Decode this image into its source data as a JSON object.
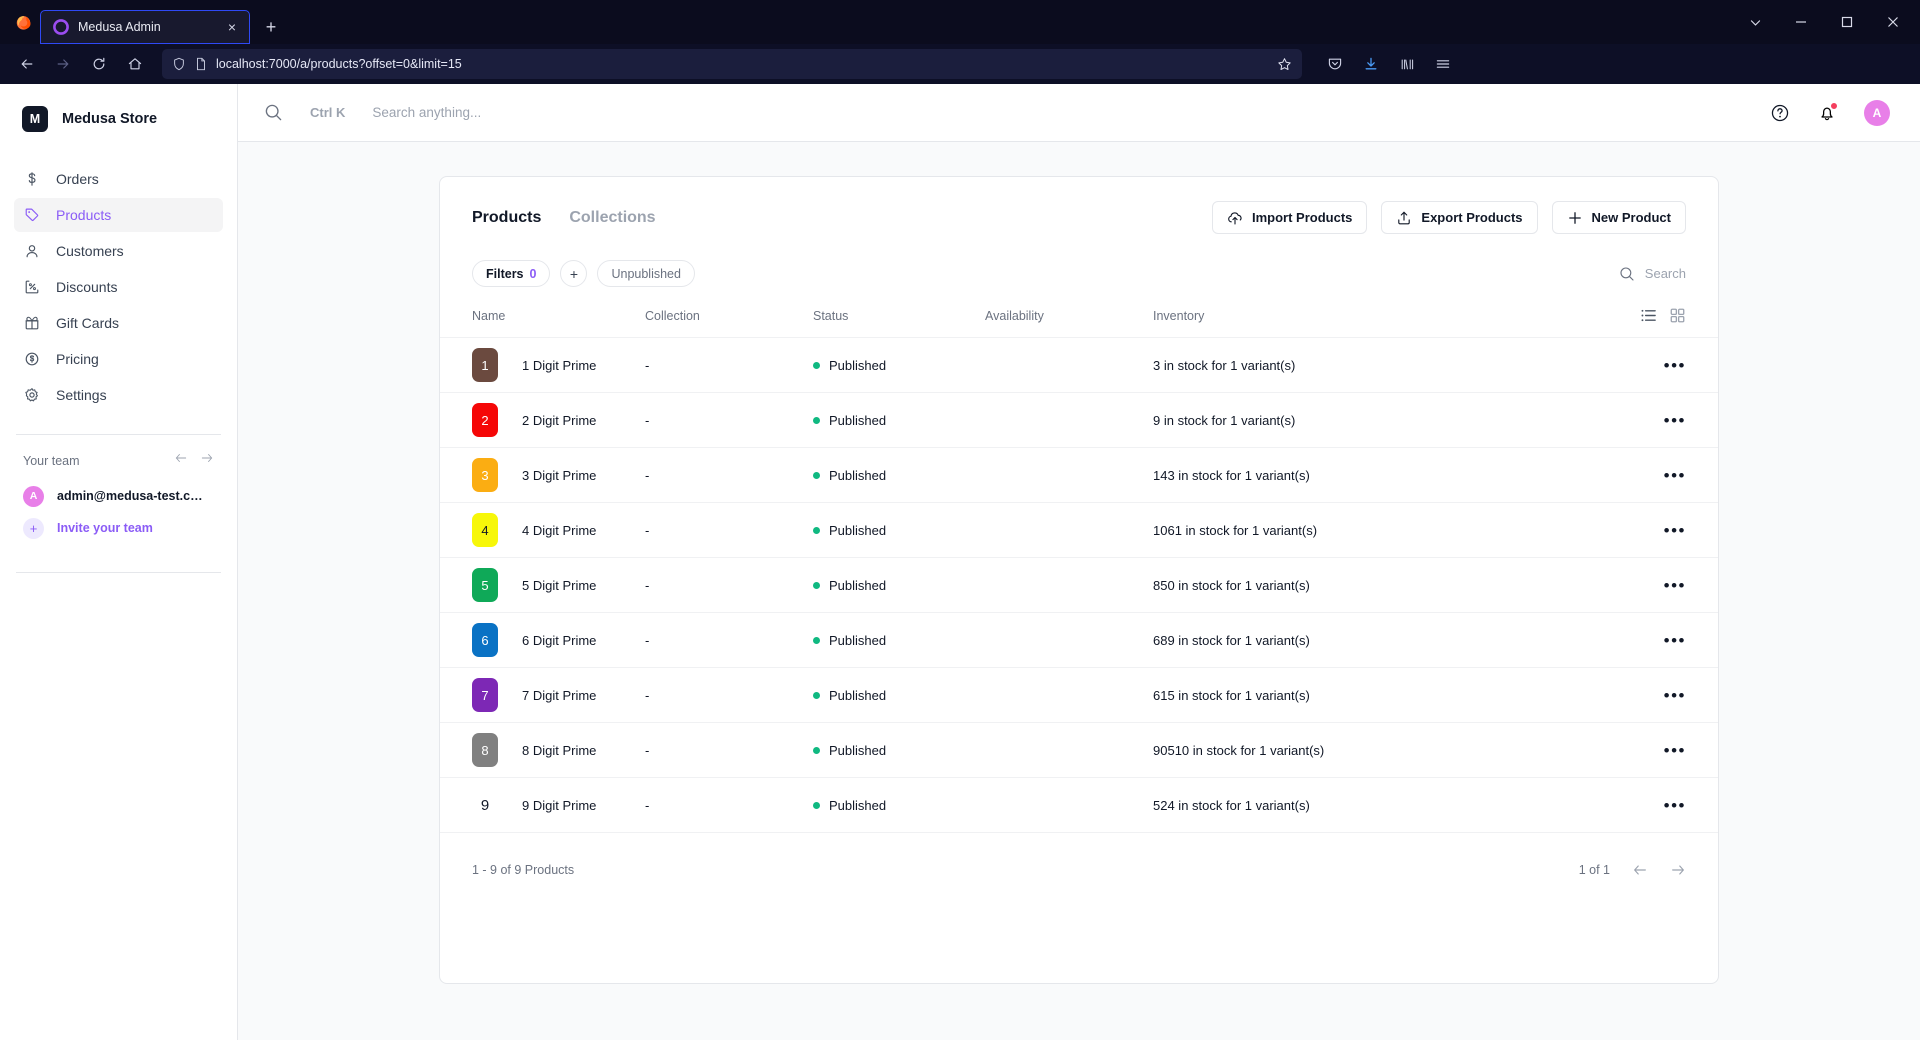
{
  "browser": {
    "tab": {
      "title": "Medusa Admin",
      "favicon": "medusa-favicon",
      "close_label": "×"
    },
    "new_tab_label": "+",
    "url": "localhost:7000/a/products?offset=0&limit=15",
    "window_controls": {
      "minimize": "—",
      "maximize": "□",
      "close": "✕",
      "list_all_tabs": "⌄"
    }
  },
  "sidebar": {
    "store_initial": "M",
    "store_name": "Medusa Store",
    "items": [
      {
        "label": "Orders",
        "icon": "dollar-icon",
        "active": false
      },
      {
        "label": "Products",
        "icon": "tag-icon",
        "active": true
      },
      {
        "label": "Customers",
        "icon": "user-icon",
        "active": false
      },
      {
        "label": "Discounts",
        "icon": "percent-icon",
        "active": false
      },
      {
        "label": "Gift Cards",
        "icon": "gift-icon",
        "active": false
      },
      {
        "label": "Pricing",
        "icon": "coin-dollar-icon",
        "active": false
      },
      {
        "label": "Settings",
        "icon": "gear-icon",
        "active": false
      }
    ],
    "team": {
      "title": "Your team",
      "member_initial": "A",
      "member_email": "admin@medusa-test.co…",
      "member_avatar_color": "#e87fe8",
      "invite_label": "Invite your team",
      "invite_plus": "+"
    }
  },
  "topbar": {
    "search_shortcut": "Ctrl K",
    "search_placeholder": "Search anything...",
    "help_icon": "question-circle-icon",
    "notifications_icon": "bell-icon",
    "avatar_initial": "A",
    "avatar_color": "#e87fe8",
    "notification_dot_color": "#f43f5e"
  },
  "main": {
    "tabs": [
      {
        "label": "Products",
        "active": true
      },
      {
        "label": "Collections",
        "active": false
      }
    ],
    "actions": [
      {
        "label": "Import Products",
        "icon": "cloud-upload-icon"
      },
      {
        "label": "Export Products",
        "icon": "upload-tray-icon"
      },
      {
        "label": "New Product",
        "icon": "plus-icon"
      }
    ],
    "filters": {
      "label": "Filters",
      "count": "0",
      "add_label": "+",
      "saved_label": "Unpublished"
    },
    "table_search_placeholder": "Search",
    "view_modes": [
      {
        "name": "list-view",
        "active": true
      },
      {
        "name": "grid-view",
        "active": false
      }
    ],
    "columns": [
      "Name",
      "Collection",
      "Status",
      "Availability",
      "Inventory"
    ],
    "rows": [
      {
        "thumb": "1",
        "thumb_color": "#6b4a3f",
        "thumb_text_color": "#ffffff",
        "name": "1 Digit Prime",
        "collection": "-",
        "status": "Published",
        "status_color": "#10b981",
        "availability": "",
        "inventory": "3 in stock for 1 variant(s)",
        "menu": "•••"
      },
      {
        "thumb": "2",
        "thumb_color": "#f50707",
        "thumb_text_color": "#ffffff",
        "name": "2 Digit Prime",
        "collection": "-",
        "status": "Published",
        "status_color": "#10b981",
        "availability": "",
        "inventory": "9 in stock for 1 variant(s)",
        "menu": "•••"
      },
      {
        "thumb": "3",
        "thumb_color": "#fbad12",
        "thumb_text_color": "#ffffff",
        "name": "3 Digit Prime",
        "collection": "-",
        "status": "Published",
        "status_color": "#10b981",
        "availability": "",
        "inventory": "143 in stock for 1 variant(s)",
        "menu": "•••"
      },
      {
        "thumb": "4",
        "thumb_color": "#f7f709",
        "thumb_text_color": "#111827",
        "name": "4 Digit Prime",
        "collection": "-",
        "status": "Published",
        "status_color": "#10b981",
        "availability": "",
        "inventory": "1061 in stock for 1 variant(s)",
        "menu": "•••"
      },
      {
        "thumb": "5",
        "thumb_color": "#0fa958",
        "thumb_text_color": "#ffffff",
        "name": "5 Digit Prime",
        "collection": "-",
        "status": "Published",
        "status_color": "#10b981",
        "availability": "",
        "inventory": "850 in stock for 1 variant(s)",
        "menu": "•••"
      },
      {
        "thumb": "6",
        "thumb_color": "#0a72c4",
        "thumb_text_color": "#ffffff",
        "name": "6 Digit Prime",
        "collection": "-",
        "status": "Published",
        "status_color": "#10b981",
        "availability": "",
        "inventory": "689 in stock for 1 variant(s)",
        "menu": "•••"
      },
      {
        "thumb": "7",
        "thumb_color": "#7d28b5",
        "thumb_text_color": "#ffffff",
        "name": "7 Digit Prime",
        "collection": "-",
        "status": "Published",
        "status_color": "#10b981",
        "availability": "",
        "inventory": "615 in stock for 1 variant(s)",
        "menu": "•••"
      },
      {
        "thumb": "8",
        "thumb_color": "#808080",
        "thumb_text_color": "#ffffff",
        "name": "8 Digit Prime",
        "collection": "-",
        "status": "Published",
        "status_color": "#10b981",
        "availability": "",
        "inventory": "90510 in stock for 1 variant(s)",
        "menu": "•••"
      },
      {
        "thumb": "9",
        "thumb_color": "transparent",
        "thumb_text_color": "#111827",
        "name": "9 Digit Prime",
        "collection": "-",
        "status": "Published",
        "status_color": "#10b981",
        "availability": "",
        "inventory": "524 in stock for 1 variant(s)",
        "menu": "•••"
      }
    ],
    "footer": {
      "summary": "1 - 9 of 9 Products",
      "page": "1 of 1"
    }
  }
}
